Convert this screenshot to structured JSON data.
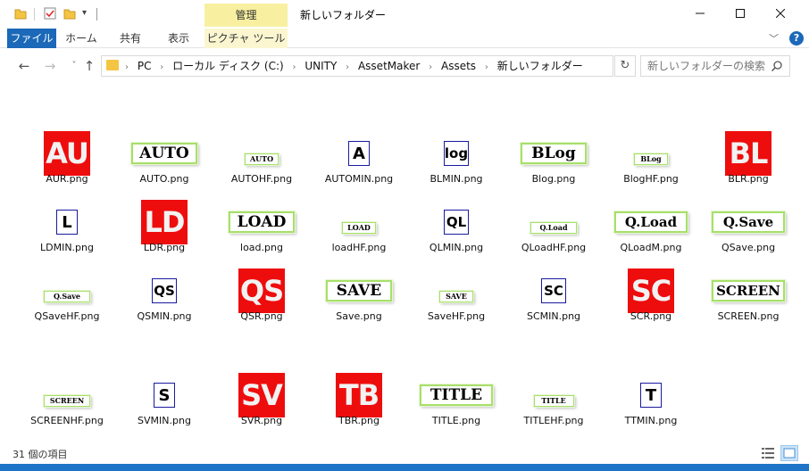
{
  "window": {
    "title": "新しいフォルダー",
    "context_tab_header": "管理"
  },
  "ribbon": {
    "tabs": [
      "ファイル",
      "ホーム",
      "共有",
      "表示",
      "ピクチャ ツール"
    ]
  },
  "address": {
    "breadcrumbs": [
      "PC",
      "ローカル ディスク (C:)",
      "UNITY",
      "AssetMaker",
      "Assets",
      "新しいフォルダー"
    ]
  },
  "search": {
    "placeholder": "新しいフォルダーの検索"
  },
  "files": [
    {
      "name": "AUR.png",
      "label": "AU",
      "style": "red"
    },
    {
      "name": "AUTO.png",
      "label": "AUTO",
      "style": "btn"
    },
    {
      "name": "AUTOHF.png",
      "label": "AUTO",
      "style": "btn-small"
    },
    {
      "name": "AUTOMIN.png",
      "label": "A",
      "style": "min"
    },
    {
      "name": "BLMIN.png",
      "label": "log",
      "style": "min"
    },
    {
      "name": "Blog.png",
      "label": "BLog",
      "style": "btn"
    },
    {
      "name": "BlogHF.png",
      "label": "BLog",
      "style": "btn-small"
    },
    {
      "name": "BLR.png",
      "label": "BL",
      "style": "red"
    },
    {
      "name": "LDMIN.png",
      "label": "L",
      "style": "min"
    },
    {
      "name": "LDR.png",
      "label": "LD",
      "style": "red"
    },
    {
      "name": "load.png",
      "label": "LOAD",
      "style": "btn"
    },
    {
      "name": "loadHF.png",
      "label": "LOAD",
      "style": "btn-small"
    },
    {
      "name": "QLMIN.png",
      "label": "QL",
      "style": "min"
    },
    {
      "name": "QLoadHF.png",
      "label": "Q.Load",
      "style": "btn-small"
    },
    {
      "name": "QLoadM.png",
      "label": "Q.Load",
      "style": "btn"
    },
    {
      "name": "QSave.png",
      "label": "Q.Save",
      "style": "btn"
    },
    {
      "name": "QSaveHF.png",
      "label": "Q.Save",
      "style": "btn-small"
    },
    {
      "name": "QSMIN.png",
      "label": "QS",
      "style": "min"
    },
    {
      "name": "QSR.png",
      "label": "QS",
      "style": "red"
    },
    {
      "name": "Save.png",
      "label": "SAVE",
      "style": "btn"
    },
    {
      "name": "SaveHF.png",
      "label": "SAVE",
      "style": "btn-small"
    },
    {
      "name": "SCMIN.png",
      "label": "SC",
      "style": "min"
    },
    {
      "name": "SCR.png",
      "label": "SC",
      "style": "red"
    },
    {
      "name": "SCREEN.png",
      "label": "SCREEN",
      "style": "btn"
    },
    {
      "name": "SCREENHF.png",
      "label": "SCREEN",
      "style": "btn-small"
    },
    {
      "name": "SVMIN.png",
      "label": "S",
      "style": "min"
    },
    {
      "name": "SVR.png",
      "label": "SV",
      "style": "red"
    },
    {
      "name": "TBR.png",
      "label": "TB",
      "style": "red"
    },
    {
      "name": "TITLE.png",
      "label": "TITLE",
      "style": "btn"
    },
    {
      "name": "TITLEHF.png",
      "label": "TITLE",
      "style": "btn-small"
    },
    {
      "name": "TTMIN.png",
      "label": "T",
      "style": "min"
    }
  ],
  "status": {
    "item_count": "31 個の項目"
  },
  "colors": {
    "accent": "#1b69b8",
    "red_icon": "#ee0d0d",
    "button_border": "#a6e06a",
    "context_tab": "#f8f0a0"
  }
}
